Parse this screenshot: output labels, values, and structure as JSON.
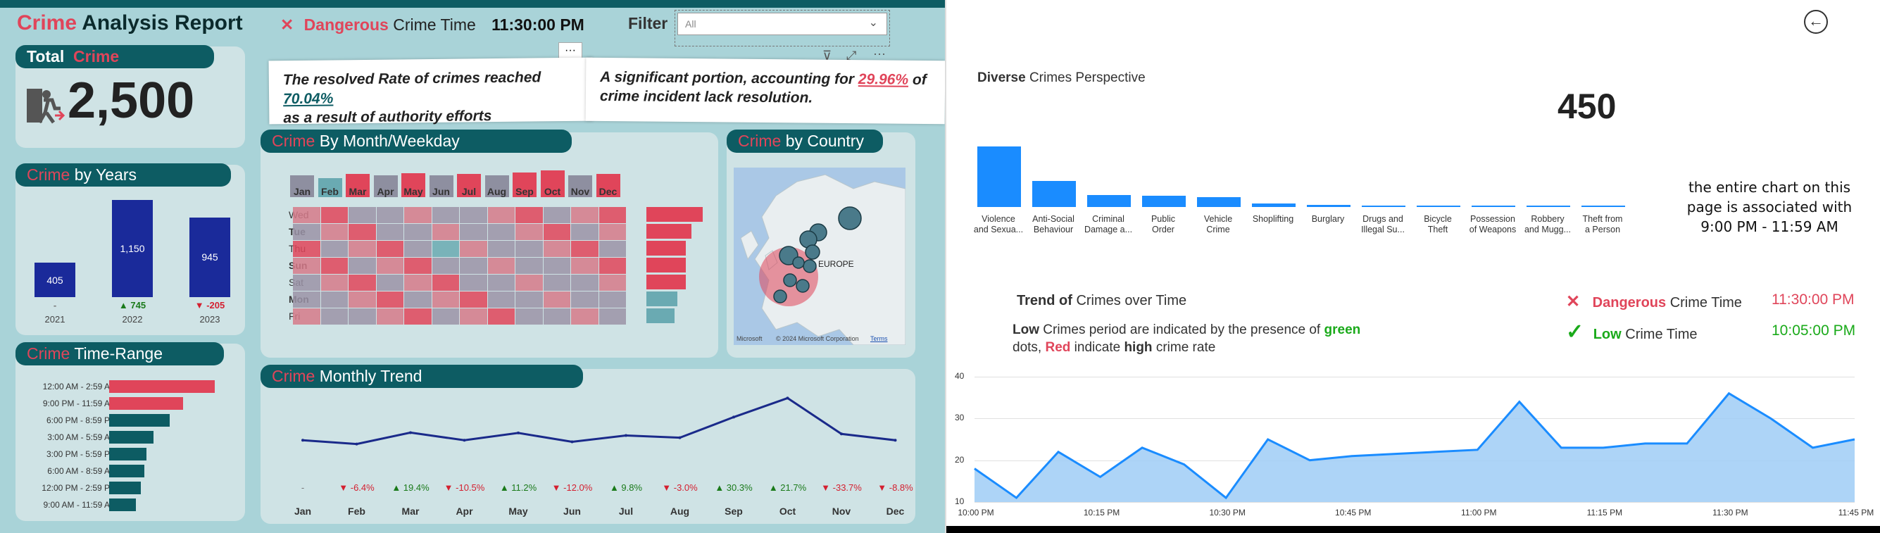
{
  "header": {
    "title_red": "Crime",
    "title_rest": " Analysis Report"
  },
  "time_banner": {
    "x": "✕",
    "word": "Dangerous",
    "rest": " Crime Time",
    "time": "11:30:00 PM"
  },
  "filter": {
    "label": "Filter",
    "value": "All"
  },
  "total": {
    "label_a": "Total",
    "label_b": "Crime",
    "value": "2,500"
  },
  "notes": {
    "left_text_a": "The resolved Rate of crimes reached ",
    "left_pct": "70.04%",
    "left_text_b": "as a result of authority efforts",
    "right_text_a": "A significant portion, accounting for ",
    "right_pct": "29.96%",
    "right_text_b": " of",
    "right_text_c": "crime incident lack resolution."
  },
  "years": {
    "title_red": "Crime",
    "title_rest": " by Years",
    "items": [
      {
        "year": "2021",
        "value": 405,
        "label": "405",
        "change": "-",
        "dir": "neutral"
      },
      {
        "year": "2022",
        "value": 1150,
        "label": "1,150",
        "change": "▲ 745",
        "dir": "up"
      },
      {
        "year": "2023",
        "value": 945,
        "label": "945",
        "change": "▼ -205",
        "dir": "down"
      }
    ]
  },
  "time_range": {
    "title_red": "Crime",
    "title_rest": " Time-Range",
    "items": [
      {
        "label": "12:00 AM - 2:59 AM",
        "value": 100,
        "color": "#e0455a"
      },
      {
        "label": "9:00 PM - 11:59 AM",
        "value": 70,
        "color": "#e0455a"
      },
      {
        "label": "6:00 PM - 8:59 PM",
        "value": 57,
        "color": "#0d5c63"
      },
      {
        "label": "3:00 AM - 5:59 AM",
        "value": 42,
        "color": "#0d5c63"
      },
      {
        "label": "3:00 PM - 5:59 PM",
        "value": 35,
        "color": "#0d5c63"
      },
      {
        "label": "6:00 AM - 8:59 AM",
        "value": 33,
        "color": "#0d5c63"
      },
      {
        "label": "12:00 PM - 2:59 PM",
        "value": 30,
        "color": "#0d5c63"
      },
      {
        "label": "9:00 AM - 11:59 AM",
        "value": 25,
        "color": "#0d5c63"
      }
    ]
  },
  "month_weekday": {
    "title_red": "Crime",
    "title_rest": " By Month/Weekday",
    "dash": "-",
    "months": [
      "Jan",
      "Feb",
      "Mar",
      "Apr",
      "May",
      "Jun",
      "Jul",
      "Aug",
      "Sep",
      "Oct",
      "Nov",
      "Dec"
    ],
    "weekdays": [
      "Wed",
      "Tue",
      "Thu",
      "Sun",
      "Sat",
      "Mon",
      "Fri"
    ],
    "weekday_bold": [
      false,
      true,
      false,
      true,
      false,
      true,
      false
    ],
    "month_levels": [
      0.5,
      0.3,
      0.6,
      0.5,
      0.65,
      0.5,
      0.6,
      0.5,
      0.75,
      0.9,
      0.5,
      0.6
    ],
    "weekday_levels": [
      0.9,
      0.7,
      0.6,
      0.6,
      0.6,
      0.45,
      0.4
    ]
  },
  "country": {
    "title_red": "Crime",
    "title_rest": " by Country",
    "map_label": "EUROPE",
    "copyright": "© 2024 Microsoft Corporation",
    "terms": "Terms",
    "brand": "Microsoft"
  },
  "monthly_trend": {
    "title_red": "Crime",
    "title_rest": " Monthly Trend",
    "months": [
      "Jan",
      "Feb",
      "Mar",
      "Apr",
      "May",
      "Jun",
      "Jul",
      "Aug",
      "Sep",
      "Oct",
      "Nov",
      "Dec"
    ],
    "values": [
      205,
      193,
      229,
      205,
      228,
      200,
      220,
      213,
      278,
      338,
      225,
      205
    ],
    "changes": [
      "-",
      "▼ -6.4%",
      "▲ 19.4%",
      "▼ -10.5%",
      "▲ 11.2%",
      "▼ -12.0%",
      "▲ 9.8%",
      "▼ -3.0%",
      "▲ 30.3%",
      "▲ 21.7%",
      "▼ -33.7%",
      "▼ -8.8%"
    ],
    "dirs": [
      "neutral",
      "down",
      "up",
      "down",
      "up",
      "down",
      "up",
      "down",
      "up",
      "up",
      "down",
      "down"
    ]
  },
  "diverse": {
    "title_bold": "Diverse",
    "title_rest": " Crimes Perspective",
    "big_number": "450",
    "note_line1": "the entire chart on this",
    "note_line2": "page is associated with",
    "note_line3": "9:00 PM - 11:59 AM",
    "categories": [
      [
        "Violence",
        "and Sexua..."
      ],
      [
        "Anti-Social",
        "Behaviour"
      ],
      [
        "Criminal",
        "Damage a..."
      ],
      [
        "Public",
        "Order"
      ],
      [
        "Vehicle",
        "Crime"
      ],
      [
        "Shoplifting",
        ""
      ],
      [
        "Burglary",
        ""
      ],
      [
        "Drugs and",
        "Illegal Su..."
      ],
      [
        "Bicycle",
        "Theft"
      ],
      [
        "Possession",
        "of Weapons"
      ],
      [
        "Robbery",
        "and Mugg..."
      ],
      [
        "Theft from",
        "a Person"
      ]
    ],
    "values": [
      150,
      65,
      30,
      28,
      25,
      8,
      6,
      4,
      3,
      2,
      2,
      2
    ]
  },
  "trend_over_time": {
    "title_bold": "Trend of",
    "title_rest": " Crimes over Time",
    "desc_a_bold": "Low",
    "desc_a": " Crimes period are indicated by the presence of ",
    "desc_a_green": "green",
    "desc_b": "dots, ",
    "desc_b_red": "Red",
    "desc_b_mid": " indicate ",
    "desc_b_bold": "high",
    "desc_b_end": " crime rate",
    "dangerous_word": "Dangerous",
    "dangerous_rest": " Crime Time",
    "dangerous_time": "11:30:00 PM",
    "low_word": "Low",
    "low_rest": " Crime Time",
    "low_time": "10:05:00 PM",
    "yticks": [
      "40",
      "30",
      "20",
      "10"
    ],
    "xticks": [
      "10:00 PM",
      "10:15 PM",
      "10:30 PM",
      "10:45 PM",
      "11:00 PM",
      "11:15 PM",
      "11:30 PM",
      "11:45 PM"
    ],
    "values": [
      18,
      11,
      22,
      16,
      23,
      19,
      11,
      25,
      20,
      21,
      21.5,
      22,
      22.5,
      34,
      23,
      23,
      24,
      24,
      36,
      30,
      23,
      25
    ],
    "ylim": [
      10,
      40
    ]
  },
  "colors": {
    "teal": "#0d5c63",
    "red": "#e0455a",
    "navy": "#1a2a9a",
    "blue": "#1a8cff",
    "green": "#1aaa1a"
  }
}
